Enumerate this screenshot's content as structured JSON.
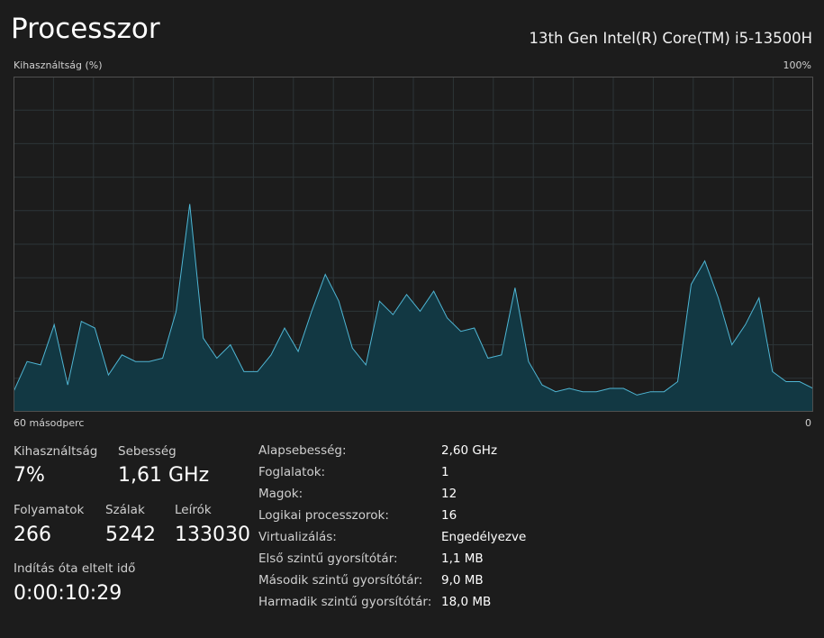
{
  "header": {
    "title": "Processzor",
    "cpu_model": "13th Gen Intel(R) Core(TM) i5-13500H"
  },
  "graph": {
    "y_label": "Kihasználtság (%)",
    "y_max_label": "100%",
    "x_left_label": "60 másodperc",
    "x_right_label": "0",
    "colors": {
      "line": "#4fb6d4",
      "fill": "#123843",
      "grid": "#2d3538",
      "border": "#4f4f4f"
    }
  },
  "chart_data": {
    "type": "area",
    "ylim": [
      0,
      100
    ],
    "xlim": [
      60,
      0
    ],
    "grid": true,
    "series": [
      {
        "values": [
          6,
          15,
          14,
          26,
          8,
          27,
          25,
          11,
          17,
          15,
          15,
          16,
          30,
          62,
          22,
          16,
          20,
          12,
          12,
          17,
          25,
          18,
          30,
          41,
          33,
          19,
          14,
          33,
          29,
          35,
          30,
          36,
          28,
          24,
          25,
          16,
          17,
          37,
          15,
          8,
          6,
          7,
          6,
          6,
          7,
          7,
          5,
          6,
          6,
          9,
          38,
          45,
          34,
          20,
          26,
          34,
          12,
          9,
          9,
          7
        ]
      }
    ]
  },
  "stats": {
    "utilization": {
      "label": "Kihasználtság",
      "value": "7%"
    },
    "speed": {
      "label": "Sebesség",
      "value": "1,61 GHz"
    },
    "processes": {
      "label": "Folyamatok",
      "value": "266"
    },
    "threads": {
      "label": "Szálak",
      "value": "5242"
    },
    "handles": {
      "label": "Leírók",
      "value": "133030"
    },
    "uptime": {
      "label": "Indítás óta eltelt idő",
      "value": "0:00:10:29"
    }
  },
  "specs": [
    {
      "key": "Alapsebesség:",
      "value": "2,60 GHz"
    },
    {
      "key": "Foglalatok:",
      "value": "1"
    },
    {
      "key": "Magok:",
      "value": "12"
    },
    {
      "key": "Logikai processzorok:",
      "value": "16"
    },
    {
      "key": "Virtualizálás:",
      "value": "Engedélyezve"
    },
    {
      "key": "Első szintű gyorsítótár:",
      "value": "1,1 MB"
    },
    {
      "key": "Második szintű gyorsítótár:",
      "value": "9,0 MB"
    },
    {
      "key": "Harmadik szintű gyorsítótár:",
      "value": "18,0 MB"
    }
  ]
}
